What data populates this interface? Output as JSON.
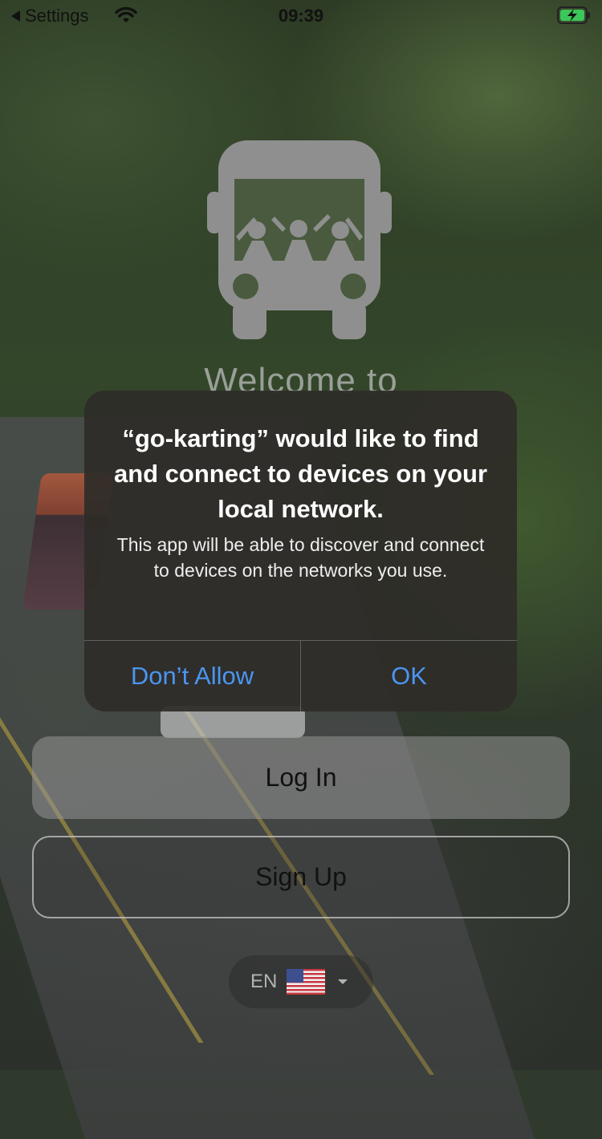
{
  "status_bar": {
    "back_label": "Settings",
    "time": "09:39",
    "icons": [
      "back-arrow-icon",
      "wifi-icon",
      "battery-charging-icon"
    ]
  },
  "app": {
    "logo_icon": "bus-with-people-icon",
    "welcome_text": "Welcome to"
  },
  "alert": {
    "title": "“go-karting” would like to find and connect to devices on your local network.",
    "message": "This app will be able to discover and connect to devices on the networks you use.",
    "deny_label": "Don’t Allow",
    "ok_label": "OK",
    "button_color": "#4a95f2"
  },
  "actions": {
    "login_label": "Log In",
    "signup_label": "Sign Up"
  },
  "language": {
    "code": "EN",
    "flag_icon": "us-flag-icon",
    "dropdown_icon": "caret-down-icon"
  }
}
